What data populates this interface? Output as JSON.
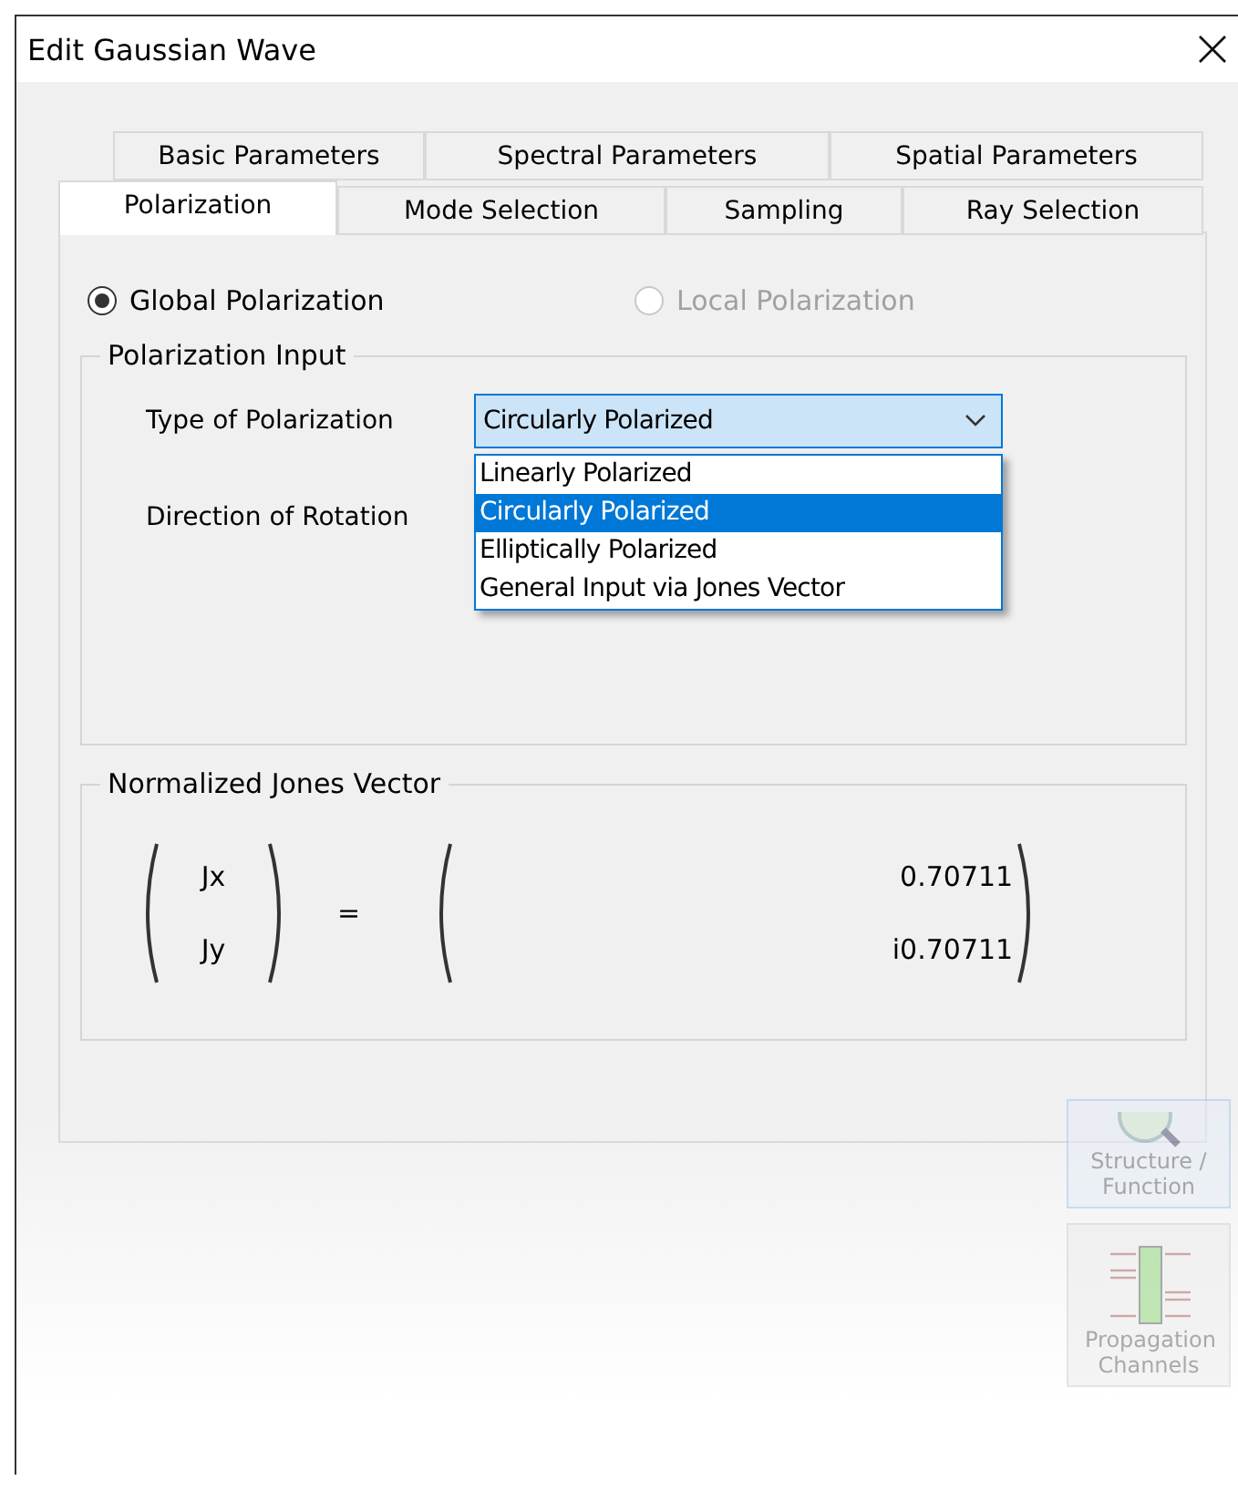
{
  "window": {
    "title": "Edit Gaussian Wave"
  },
  "tab_rows": [
    [
      {
        "label": "Basic Parameters",
        "selected": false
      },
      {
        "label": "Spectral Parameters",
        "selected": false
      },
      {
        "label": "Spatial Parameters",
        "selected": false
      }
    ],
    [
      {
        "label": "Polarization",
        "selected": true
      },
      {
        "label": "Mode Selection",
        "selected": false
      },
      {
        "label": "Sampling",
        "selected": false
      },
      {
        "label": "Ray Selection",
        "selected": false
      }
    ]
  ],
  "radios": [
    {
      "label": "Global Polarization",
      "selected": true,
      "disabled": false
    },
    {
      "label": "Local Polarization",
      "selected": false,
      "disabled": true
    }
  ],
  "polarization_input": {
    "title": "Polarization Input",
    "type_field": {
      "label": "Type of Polarization",
      "value": "Circularly Polarized",
      "expanded": true,
      "options": [
        {
          "label": "Linearly Polarized",
          "selected": false
        },
        {
          "label": "Circularly Polarized",
          "selected": true
        },
        {
          "label": "Elliptically Polarized",
          "selected": false
        },
        {
          "label": "General Input via Jones Vector",
          "selected": false
        }
      ]
    },
    "rotation_field": {
      "label": "Direction of Rotation"
    }
  },
  "jones_vector": {
    "title": "Normalized Jones Vector",
    "components": [
      "Jx",
      "Jy"
    ],
    "equals": "=",
    "values": [
      "0.70711",
      "i0.70711"
    ]
  },
  "side_toolbar": [
    {
      "kind": "structure",
      "label": "Structure / Function"
    },
    {
      "kind": "channels",
      "label": "Propagation Channels"
    }
  ]
}
